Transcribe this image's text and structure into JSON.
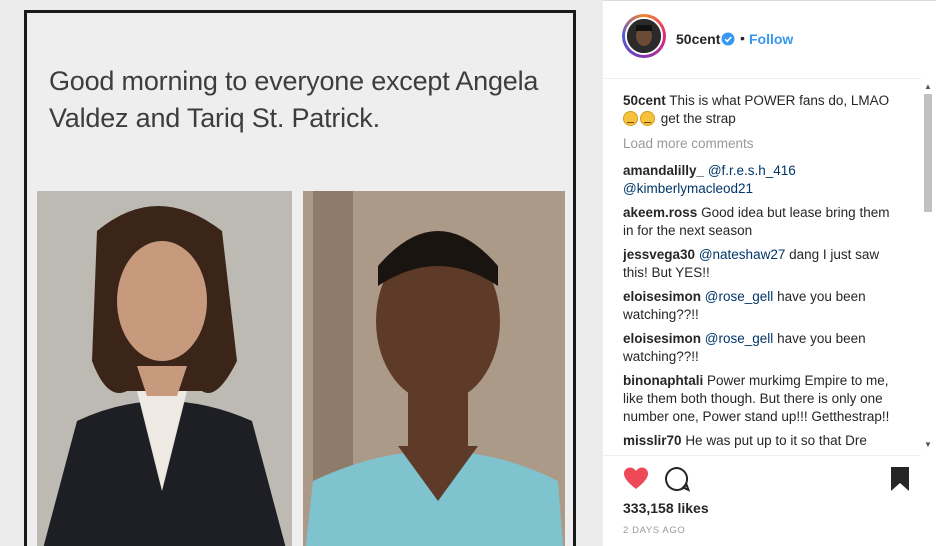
{
  "post": {
    "meme_caption": "Good morning to everyone except Angela Valdez and Tariq St. Patrick."
  },
  "header": {
    "username": "50cent",
    "separator": "•",
    "follow_label": "Follow"
  },
  "comments": {
    "caption": {
      "user": "50cent",
      "text": "This is what POWER fans do, LMAO",
      "text2": "get the strap"
    },
    "load_more_label": "Load more comments",
    "items": [
      {
        "user": "amandalilly_",
        "mention": "@f.r.e.s.h_416",
        "mention2": "@kimberlymacleod21"
      },
      {
        "user": "akeem.ross",
        "text": "Good idea but lease bring them in for the next season"
      },
      {
        "user": "jessvega30",
        "mention": "@nateshaw27",
        "text": "dang I just saw this! But YES!!"
      },
      {
        "user": "eloisesimon",
        "mention": "@rose_gell",
        "text": "have you been watching??!!"
      },
      {
        "user": "eloisesimon",
        "mention": "@rose_gell",
        "text": "have you been watching??!!"
      },
      {
        "user": "binonaphtali",
        "text": "Power murkimg Empire to me, like them both though. But there is only one number one, Power stand up!!! Getthestrap!!"
      },
      {
        "user": "misslir70",
        "text": "He was put up to it so that Dre"
      }
    ]
  },
  "likes": "333,158 likes",
  "date": "2 DAYS AGO",
  "colors": {
    "accent": "#3897f0",
    "like": "#ed4956",
    "mention": "#003569"
  },
  "icons": [
    "heart-icon",
    "comment-icon",
    "bookmark-icon",
    "verified-icon"
  ]
}
